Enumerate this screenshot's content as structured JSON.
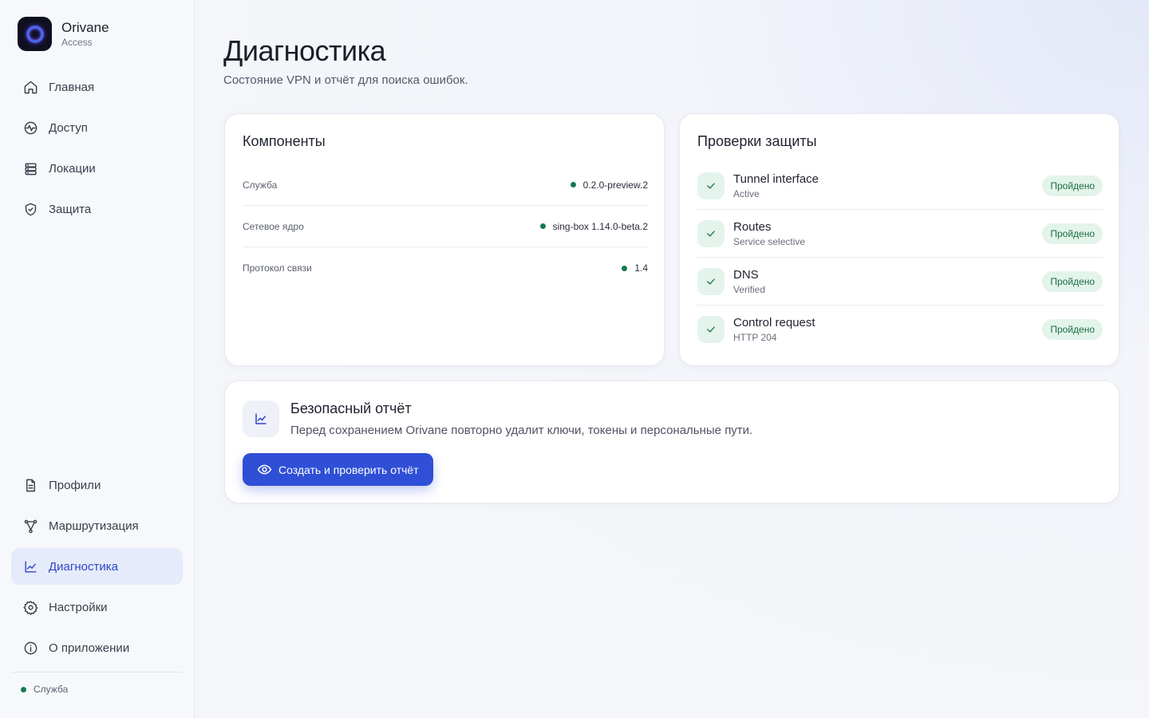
{
  "brand": {
    "name": "Orivane",
    "sub": "Access"
  },
  "nav_top": [
    {
      "label": "Главная",
      "icon": "home-icon"
    },
    {
      "label": "Доступ",
      "icon": "pulse-icon"
    },
    {
      "label": "Локации",
      "icon": "server-icon"
    },
    {
      "label": "Защита",
      "icon": "shield-icon"
    }
  ],
  "nav_bottom": [
    {
      "label": "Профили",
      "icon": "document-icon"
    },
    {
      "label": "Маршрутизация",
      "icon": "route-icon"
    },
    {
      "label": "Диагностика",
      "icon": "chart-icon",
      "active": true
    },
    {
      "label": "Настройки",
      "icon": "gear-icon"
    },
    {
      "label": "О приложении",
      "icon": "info-icon"
    }
  ],
  "service_status": {
    "label": "Служба",
    "color": "#137a4f"
  },
  "page": {
    "title": "Диагностика",
    "subtitle": "Состояние VPN и отчёт для поиска ошибок."
  },
  "components": {
    "title": "Компоненты",
    "rows": [
      {
        "label": "Служба",
        "value": "0.2.0-preview.2"
      },
      {
        "label": "Сетевое ядро",
        "value": "sing-box 1.14.0-beta.2"
      },
      {
        "label": "Протокол связи",
        "value": "1.4"
      }
    ]
  },
  "checks": {
    "title": "Проверки защиты",
    "rows": [
      {
        "name": "Tunnel interface",
        "sub": "Active",
        "status": "Пройдено"
      },
      {
        "name": "Routes",
        "sub": "Service selective",
        "status": "Пройдено"
      },
      {
        "name": "DNS",
        "sub": "Verified",
        "status": "Пройдено"
      },
      {
        "name": "Control request",
        "sub": "HTTP 204",
        "status": "Пройдено"
      }
    ]
  },
  "report": {
    "title": "Безопасный отчёт",
    "description": "Перед сохранением Orivane повторно удалит ключи, токены и персональные пути.",
    "button_label": "Создать и проверить отчёт",
    "icon": "chart-icon"
  },
  "colors": {
    "accent": "#2f4fd6",
    "success": "#137a4f",
    "active_nav_bg": "#e6ebfb"
  }
}
